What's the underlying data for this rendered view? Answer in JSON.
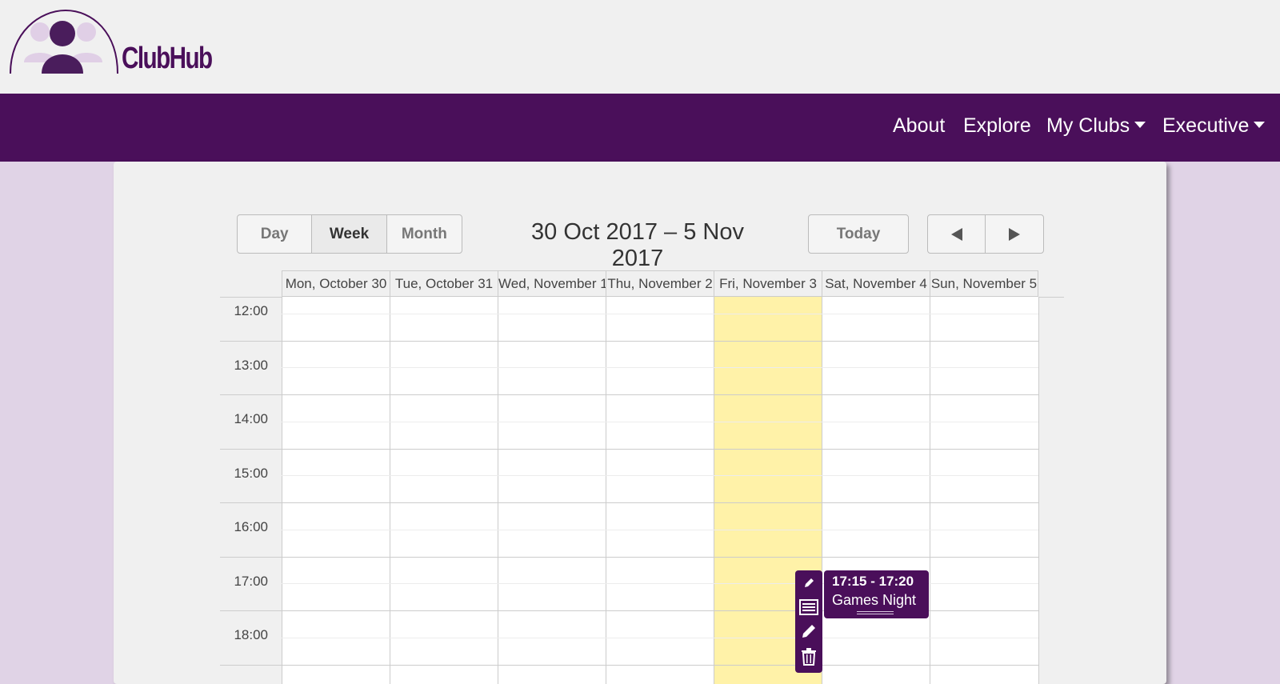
{
  "brand": {
    "name": "ClubHub",
    "logo_icon": "people-arch-logo"
  },
  "nav": {
    "items": [
      {
        "label": "About"
      },
      {
        "label": "Explore"
      },
      {
        "label": "My Clubs",
        "dropdown": true
      },
      {
        "label": "Executive",
        "dropdown": true
      }
    ]
  },
  "calendar": {
    "views": [
      "Day",
      "Week",
      "Month"
    ],
    "active_view": "Week",
    "range_title": "30 Oct 2017 – 5 Nov 2017",
    "today_label": "Today",
    "prev_icon": "triangle-left-icon",
    "next_icon": "triangle-right-icon",
    "days": [
      "Mon, October 30",
      "Tue, October 31",
      "Wed, November 1",
      "Thu, November 2",
      "Fri, November 3",
      "Sat, November 4",
      "Sun, November 5"
    ],
    "today_day": "Fri, November 3",
    "hours": [
      "12:00",
      "13:00",
      "14:00",
      "15:00",
      "16:00",
      "17:00",
      "18:00"
    ],
    "event": {
      "time": "17:15 - 17:20",
      "title": "Games Night",
      "day": "Sat, November 4"
    },
    "event_tools": [
      "pen-icon",
      "list-icon",
      "pencil-icon",
      "trash-icon"
    ]
  },
  "colors": {
    "primary": "#4a0f5a",
    "background": "#e0d3e6",
    "today_highlight": "#fff2a8"
  }
}
